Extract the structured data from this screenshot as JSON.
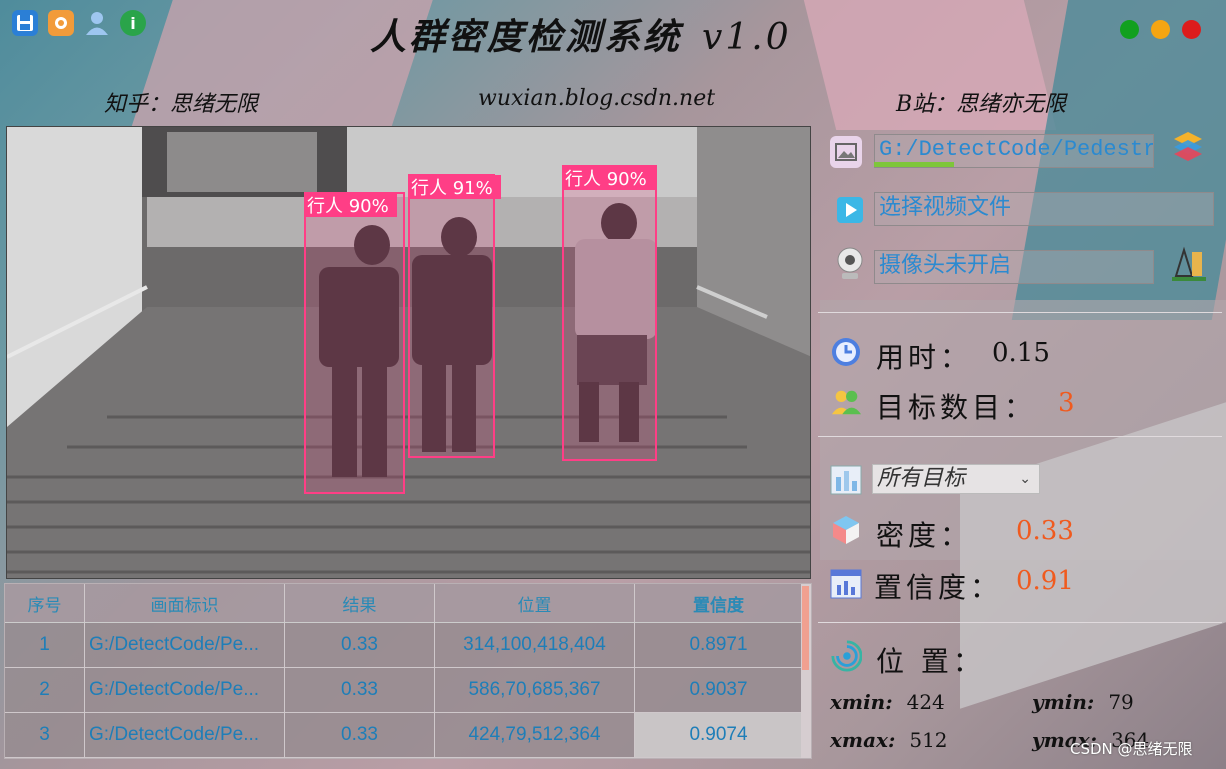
{
  "app": {
    "title": "人群密度检测系统",
    "version": "v1.0",
    "zhihu": "知乎：思绪无限",
    "blog": "wuxian.blog.csdn.net",
    "bilibili": "B站：思绪亦无限",
    "watermark": "CSDN @思绪无限"
  },
  "colors": {
    "win_green": "#12a01f",
    "win_yellow": "#f5a512",
    "win_red": "#dd1c1c",
    "accent_blue": "#2b8ad0",
    "orange_value": "#f05a1e",
    "box_pink": "#ff3e86"
  },
  "detections": [
    {
      "label": "行人 90%"
    },
    {
      "label": "行人 91%"
    },
    {
      "label": "行人 90%"
    }
  ],
  "table": {
    "headers": [
      "序号",
      "画面标识",
      "结果",
      "位置",
      "置信度"
    ],
    "rows": [
      [
        "1",
        "G:/DetectCode/Pe...",
        "0.33",
        "314,100,418,404",
        "0.8971"
      ],
      [
        "2",
        "G:/DetectCode/Pe...",
        "0.33",
        "586,70,685,367",
        "0.9037"
      ],
      [
        "3",
        "G:/DetectCode/Pe...",
        "0.33",
        "424,79,512,364",
        "0.9074"
      ]
    ]
  },
  "panel": {
    "image_path": "G:/DetectCode/Pedestria",
    "video_button": "选择视频文件",
    "camera_button": "摄像头未开启",
    "time_label": "用时：",
    "time_value": "0.15",
    "count_label": "目标数目：",
    "count_value": "3",
    "target_select": "所有目标",
    "density_label": "密度：",
    "density_value": "0.33",
    "confidence_label": "置信度：",
    "confidence_value": "0.91",
    "position_label": "位 置：",
    "xmin_label": "xmin:",
    "xmin_value": "424",
    "ymin_label": "ymin:",
    "ymin_value": "79",
    "xmax_label": "xmax:",
    "xmax_value": "512",
    "ymax_label": "ymax:",
    "ymax_value": "364"
  },
  "icons": {
    "toolbar": [
      "save-icon",
      "orange-app-icon",
      "user-icon",
      "info-icon"
    ],
    "panel": [
      "image-icon",
      "layers-icon",
      "video-play-icon",
      "webcam-icon",
      "model-logo-icon",
      "clock-icon",
      "users-icon",
      "chart-icon",
      "cube-icon",
      "bar-chart-icon",
      "signal-icon"
    ]
  }
}
